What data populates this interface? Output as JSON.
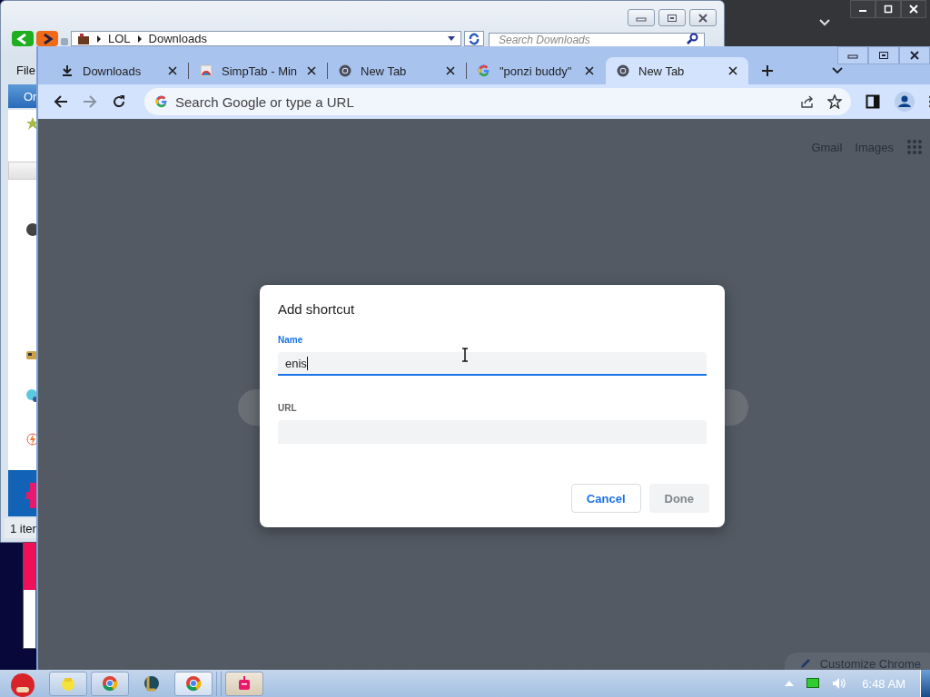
{
  "explorer": {
    "breadcrumb": [
      "LOL",
      "Downloads"
    ],
    "search": {
      "placeholder": "Search Downloads"
    },
    "menu": [
      "File"
    ],
    "pane_header": "Or",
    "status": "1 iter"
  },
  "browser": {
    "tabs": [
      {
        "title": "Downloads",
        "kind": "download",
        "selected": false
      },
      {
        "title": "SimpTab - Min",
        "selected": false
      },
      {
        "title": "New Tab",
        "kind": "chrome",
        "selected": false
      },
      {
        "title": "\"ponzi buddy\"",
        "kind": "google",
        "selected": false
      },
      {
        "title": "New Tab",
        "kind": "chrome",
        "selected": true
      }
    ],
    "omnibox": {
      "placeholder": "Search Google or type a URL"
    },
    "top_links": [
      "Gmail",
      "Images"
    ],
    "customize_button": "Customize Chrome"
  },
  "dialog": {
    "title": "Add shortcut",
    "fields": [
      {
        "label": "Name",
        "value": "enis",
        "focused": true
      },
      {
        "label": "URL",
        "focused": false
      }
    ],
    "buttons": [
      {
        "label": "Cancel",
        "disabled": false
      },
      {
        "label": "Done",
        "disabled": true
      }
    ]
  },
  "taskbar": {
    "clock": "6:48 AM"
  }
}
